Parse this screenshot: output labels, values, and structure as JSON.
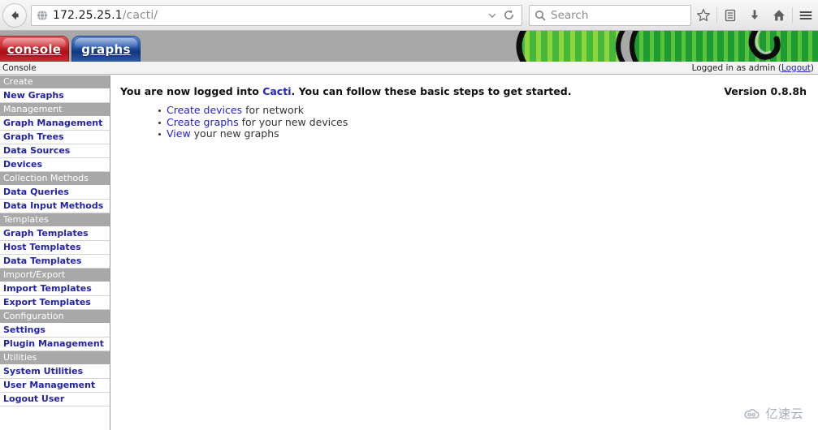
{
  "browser": {
    "back_label": "Back",
    "url_host": "172.25.25.1",
    "url_path": "/cacti/",
    "search_placeholder": "Search",
    "search_value": "",
    "icons": {
      "back": "back-arrow-icon",
      "globe": "globe-icon",
      "chevron": "chevron-down-icon",
      "reload": "reload-icon",
      "search": "search-icon",
      "bookmark": "star-icon",
      "library": "library-icon",
      "downloads": "download-icon",
      "home": "home-icon",
      "menu": "hamburger-menu-icon"
    }
  },
  "app": {
    "tabs": [
      {
        "label": "console",
        "active": true,
        "color": "#a91118"
      },
      {
        "label": "graphs",
        "active": false,
        "color": "#12377d"
      }
    ],
    "breadcrumb": "Console",
    "session_prefix": "Logged in as admin (",
    "session_user": "admin",
    "logout_label": "Logout",
    "session_suffix": ")",
    "version": "Version 0.8.8h"
  },
  "sidebar": {
    "sections": [
      {
        "header": "Create",
        "items": [
          {
            "label": "New Graphs"
          }
        ]
      },
      {
        "header": "Management",
        "items": [
          {
            "label": "Graph Management"
          },
          {
            "label": "Graph Trees"
          },
          {
            "label": "Data Sources"
          },
          {
            "label": "Devices"
          }
        ]
      },
      {
        "header": "Collection Methods",
        "items": [
          {
            "label": "Data Queries"
          },
          {
            "label": "Data Input Methods"
          }
        ]
      },
      {
        "header": "Templates",
        "items": [
          {
            "label": "Graph Templates"
          },
          {
            "label": "Host Templates"
          },
          {
            "label": "Data Templates"
          }
        ]
      },
      {
        "header": "Import/Export",
        "items": [
          {
            "label": "Import Templates"
          },
          {
            "label": "Export Templates"
          }
        ]
      },
      {
        "header": "Configuration",
        "items": [
          {
            "label": "Settings"
          },
          {
            "label": "Plugin Management"
          }
        ]
      },
      {
        "header": "Utilities",
        "items": [
          {
            "label": "System Utilities"
          },
          {
            "label": "User Management"
          },
          {
            "label": "Logout User"
          }
        ]
      }
    ]
  },
  "main": {
    "intro_pre": "You are now logged into ",
    "intro_link": "Cacti",
    "intro_post": ". You can follow these basic steps to get started.",
    "steps": [
      {
        "link": "Create devices",
        "rest": " for network"
      },
      {
        "link": "Create graphs",
        "rest": " for your new devices"
      },
      {
        "link": "View",
        "rest": " your new graphs"
      }
    ]
  },
  "watermark": {
    "text": "亿速云"
  },
  "colors": {
    "nav_header_bg": "#a8a8a8",
    "link_blue": "#2323a8",
    "tab_console_red": "#a91118",
    "tab_graphs_blue": "#12377d",
    "banner_gray": "#a8a8a8",
    "logo_green": "#5ec33a"
  }
}
